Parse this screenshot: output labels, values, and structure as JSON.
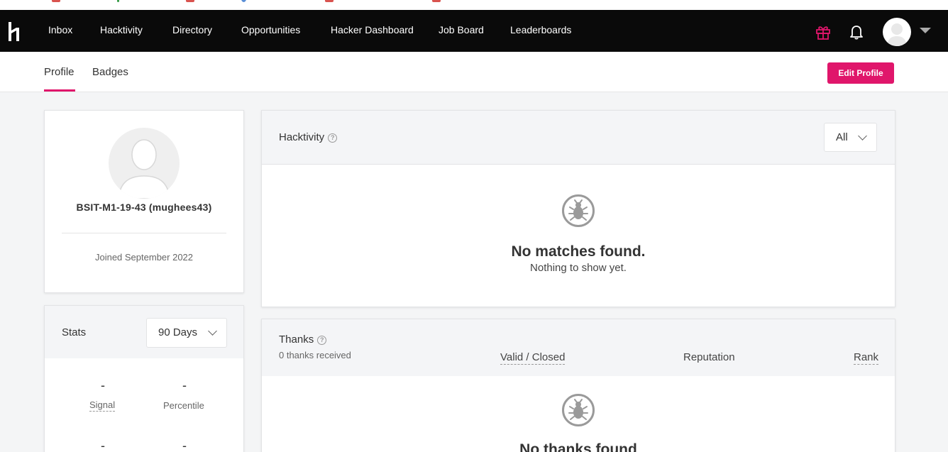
{
  "nav": {
    "items": [
      "Inbox",
      "Hacktivity",
      "Directory",
      "Opportunities",
      "Hacker Dashboard",
      "Job Board",
      "Leaderboards"
    ]
  },
  "tabs": {
    "profile": "Profile",
    "badges": "Badges"
  },
  "edit_profile_label": "Edit Profile",
  "profile": {
    "username": "BSIT-M1-19-43 (mughees43)",
    "joined": "Joined September 2022"
  },
  "stats": {
    "title": "Stats",
    "range": "90 Days",
    "signal_value": "-",
    "signal_label": "Signal",
    "percentile_value": "-",
    "percentile_label": "Percentile",
    "row2_left_value": "-",
    "row2_right_value": "-"
  },
  "hacktivity": {
    "title": "Hacktivity",
    "filter": "All",
    "empty_title": "No matches found.",
    "empty_sub": "Nothing to show yet."
  },
  "thanks": {
    "title": "Thanks",
    "received": "0 thanks received",
    "columns": [
      "Valid / Closed",
      "Reputation",
      "Rank"
    ],
    "empty_title": "No thanks found"
  },
  "colors": {
    "accent": "#e0166b",
    "nav_bg": "#0a0a0a"
  },
  "icons": [
    "hackerone-logo-icon",
    "gift-icon",
    "bell-icon",
    "user-avatar-icon",
    "chevron-down-icon",
    "help-icon",
    "bug-icon"
  ]
}
